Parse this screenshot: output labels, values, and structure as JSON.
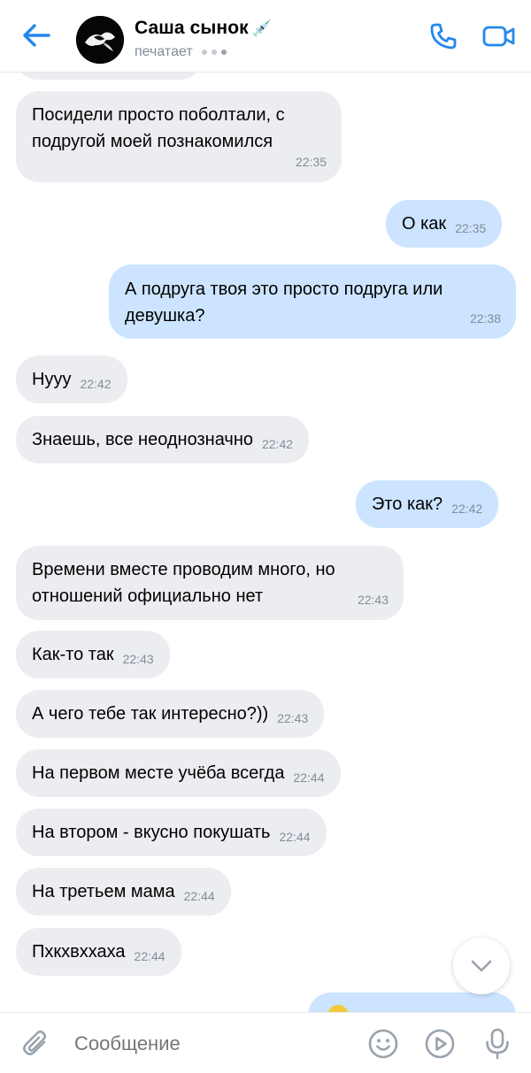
{
  "header": {
    "contact_name": "Саша сынок",
    "name_emoji": "💉",
    "status": "печатает"
  },
  "messages": [
    {
      "direction": "in",
      "text": "Посидели просто поболтали, с подругой моей познакомился",
      "lines": [
        "Посидели просто поболтали, с",
        "подругой моей познакомился"
      ],
      "time": "22:35"
    },
    {
      "direction": "out",
      "text": "О как",
      "time": "22:35"
    },
    {
      "direction": "out",
      "text": "А подруга твоя это просто подруга или девушка?",
      "lines": [
        "А подруга твоя это просто подруга или",
        "девушка?"
      ],
      "time": "22:38"
    },
    {
      "direction": "in",
      "text": "Нууу",
      "time": "22:42"
    },
    {
      "direction": "in",
      "text": "Знаешь, все неоднозначно",
      "time": "22:42"
    },
    {
      "direction": "out",
      "text": "Это как?",
      "time": "22:42"
    },
    {
      "direction": "in",
      "text": "Времени вместе проводим много, но отношений официально нет",
      "lines": [
        "Времени вместе проводим много, но",
        "отношений официально нет"
      ],
      "time": "22:43"
    },
    {
      "direction": "in",
      "text": "Как-то так",
      "time": "22:43"
    },
    {
      "direction": "in",
      "text": "А чего тебе так интересно?))",
      "time": "22:43"
    },
    {
      "direction": "in",
      "text": "На первом месте учёба всегда",
      "time": "22:44"
    },
    {
      "direction": "in",
      "text": "На втором - вкусно покушать",
      "time": "22:44"
    },
    {
      "direction": "in",
      "text": "На третьем мама",
      "time": "22:44"
    },
    {
      "direction": "in",
      "text": "Пхкхвххаха",
      "time": "22:44"
    },
    {
      "direction": "out",
      "text": "",
      "time": ""
    }
  ],
  "composer": {
    "placeholder": "Сообщение"
  },
  "colors": {
    "accent": "#2688eb",
    "incoming_bubble": "#ebedf0",
    "outgoing_bubble": "#cce4ff",
    "secondary_text": "#818c99"
  },
  "icons": {
    "back": "arrow-left-icon",
    "call": "phone-icon",
    "video": "video-camera-icon",
    "scroll_down": "chevron-down-icon",
    "attach": "paperclip-icon",
    "emoji": "smile-icon",
    "video_message": "play-circle-icon",
    "voice": "microphone-icon"
  }
}
